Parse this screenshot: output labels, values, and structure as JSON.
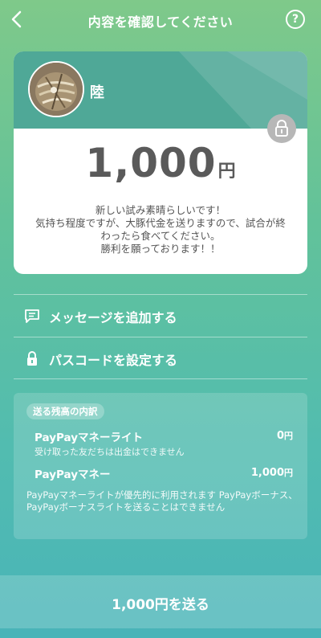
{
  "header": {
    "title": "内容を確認してください",
    "help_label": "?"
  },
  "card": {
    "recipient_name": "陸",
    "amount": "1,000",
    "currency": "円",
    "message_lines": [
      "新しい試み素晴らしいです！",
      "気持ち程度ですが、大豚代金を送りますので、試合が終",
      "わったら食べてください。",
      "勝利を願っております！！"
    ]
  },
  "actions": {
    "add_message": "メッセージを追加する",
    "set_passcode": "パスコードを設定する"
  },
  "breakdown": {
    "label": "送る残高の内訳",
    "items": [
      {
        "name": "PayPayマネーライト",
        "amount": "0",
        "unit": "円",
        "note": "受け取った友だちは出金はできません"
      },
      {
        "name": "PayPayマネー",
        "amount": "1,000",
        "unit": "円"
      }
    ],
    "footnote": "PayPayマネーライトが優先的に利用されます PayPayボーナス、PayPayボーナスライトを送ることはできません"
  },
  "send_button": "1,000円を送る",
  "colors": {
    "accent": "#4fa897",
    "text_dark": "#5a5a5a"
  }
}
